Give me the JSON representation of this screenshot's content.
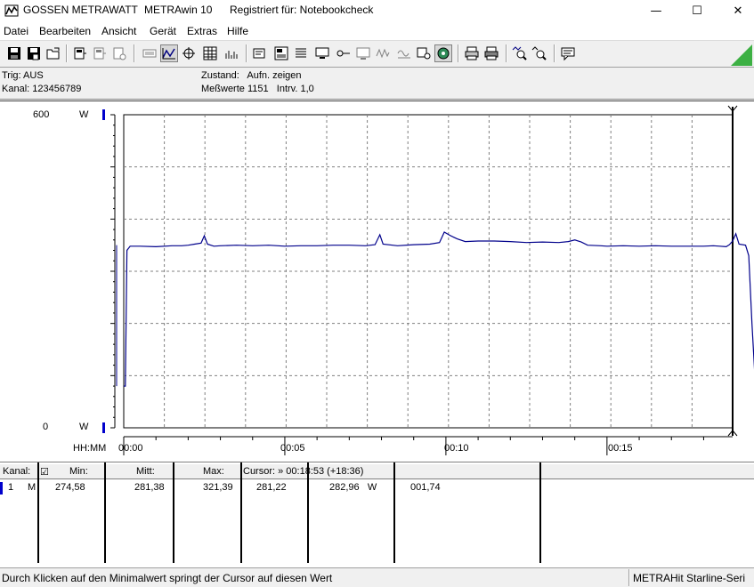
{
  "window": {
    "company": "GOSSEN METRAWATT",
    "app_name": "METRAwin 10",
    "registered": "Registriert für: Notebookcheck",
    "minimize_glyph": "—",
    "maximize_glyph": "☐",
    "close_glyph": "✕"
  },
  "menu": {
    "items": [
      "Datei",
      "Bearbeiten",
      "Ansicht",
      "Gerät",
      "Extras",
      "Hilfe"
    ]
  },
  "toolbar": {
    "buttons": [
      "save-icon",
      "save-as-icon",
      "open-folder-icon",
      "device-icon",
      "device-copy-icon",
      "device-settings-icon",
      "keyboard-icon",
      "scale-icon",
      "zoom-fit-icon",
      "table-icon",
      "histogram-icon",
      "recorder-icon",
      "recorder-config-icon",
      "list-icon",
      "monitor-icon",
      "signal-icon",
      "chart-icon",
      "waveform-icon",
      "waveform-alt-icon",
      "trigger-icon",
      "settings-gear-icon",
      "print-icon",
      "print-preview-icon",
      "zoom-icon",
      "zoom-out-icon",
      "comment-icon",
      "status-triangle-icon"
    ]
  },
  "info": {
    "trig": "Trig: AUS",
    "kanal": "Kanal: 123456789",
    "zustand": "Zustand:   Aufn. zeigen",
    "messwerte": "Meßwerte 1151   Intrv. 1,0"
  },
  "chart_data": {
    "type": "line",
    "y_axis": {
      "max_label": "600",
      "min_label": "0",
      "unit_top": "W",
      "unit_bottom": "W",
      "ylim": [
        0,
        600
      ]
    },
    "x_axis": {
      "label": "HH:MM",
      "ticks": [
        "00:00",
        "00:05",
        "00:10",
        "00:15"
      ],
      "xlim_minutes": [
        0,
        18.9
      ]
    },
    "grid": true,
    "series": [
      {
        "color": "#00008b",
        "points": [
          [
            0.0,
            80
          ],
          [
            0.05,
            80
          ],
          [
            0.1,
            340
          ],
          [
            0.2,
            348
          ],
          [
            0.5,
            348
          ],
          [
            1.0,
            347
          ],
          [
            1.5,
            349
          ],
          [
            1.8,
            349
          ],
          [
            2.0,
            350
          ],
          [
            2.2,
            352
          ],
          [
            2.4,
            354
          ],
          [
            2.5,
            368
          ],
          [
            2.6,
            352
          ],
          [
            2.8,
            348
          ],
          [
            3.0,
            349
          ],
          [
            3.5,
            350
          ],
          [
            4.0,
            349
          ],
          [
            4.5,
            350
          ],
          [
            5.0,
            348
          ],
          [
            5.5,
            349
          ],
          [
            6.0,
            349
          ],
          [
            6.5,
            350
          ],
          [
            7.0,
            350
          ],
          [
            7.5,
            349
          ],
          [
            7.8,
            351
          ],
          [
            7.95,
            370
          ],
          [
            8.05,
            352
          ],
          [
            8.5,
            349
          ],
          [
            9.0,
            351
          ],
          [
            9.5,
            352
          ],
          [
            9.8,
            355
          ],
          [
            9.95,
            375
          ],
          [
            10.15,
            368
          ],
          [
            10.35,
            362
          ],
          [
            10.6,
            357
          ],
          [
            11.0,
            358
          ],
          [
            11.5,
            358
          ],
          [
            12.0,
            357
          ],
          [
            12.5,
            355
          ],
          [
            13.0,
            356
          ],
          [
            13.5,
            355
          ],
          [
            13.8,
            357
          ],
          [
            14.0,
            360
          ],
          [
            14.2,
            356
          ],
          [
            14.4,
            350
          ],
          [
            14.8,
            349
          ],
          [
            15.0,
            348
          ],
          [
            15.5,
            349
          ],
          [
            16.0,
            348
          ],
          [
            16.5,
            349
          ],
          [
            17.0,
            348
          ],
          [
            17.5,
            348
          ],
          [
            18.0,
            348
          ],
          [
            18.3,
            349
          ],
          [
            18.5,
            348
          ],
          [
            18.7,
            347
          ],
          [
            18.8,
            351
          ],
          [
            18.9,
            358
          ],
          [
            19.0,
            372
          ],
          [
            19.1,
            352
          ],
          [
            19.3,
            350
          ],
          [
            19.4,
            330
          ],
          [
            19.5,
            200
          ],
          [
            19.6,
            90
          ]
        ]
      }
    ]
  },
  "table": {
    "headers": {
      "kanal": "Kanal:",
      "check": "☑",
      "min": "Min:",
      "mitt": "Mitt:",
      "max": "Max:",
      "cursor": "Cursor: » 00:18:53 (+18:36)"
    },
    "row": {
      "kanal": "1",
      "m": "M",
      "min": "274,58",
      "mitt": "281,38",
      "max": "321,39",
      "cursor1": "281,22",
      "cursor2": "282,96   W",
      "cursor3": "001,74"
    }
  },
  "status": {
    "left": "Durch Klicken auf den Minimalwert springt der Cursor auf diesen Wert",
    "right": "METRAHit Starline-Seri"
  }
}
